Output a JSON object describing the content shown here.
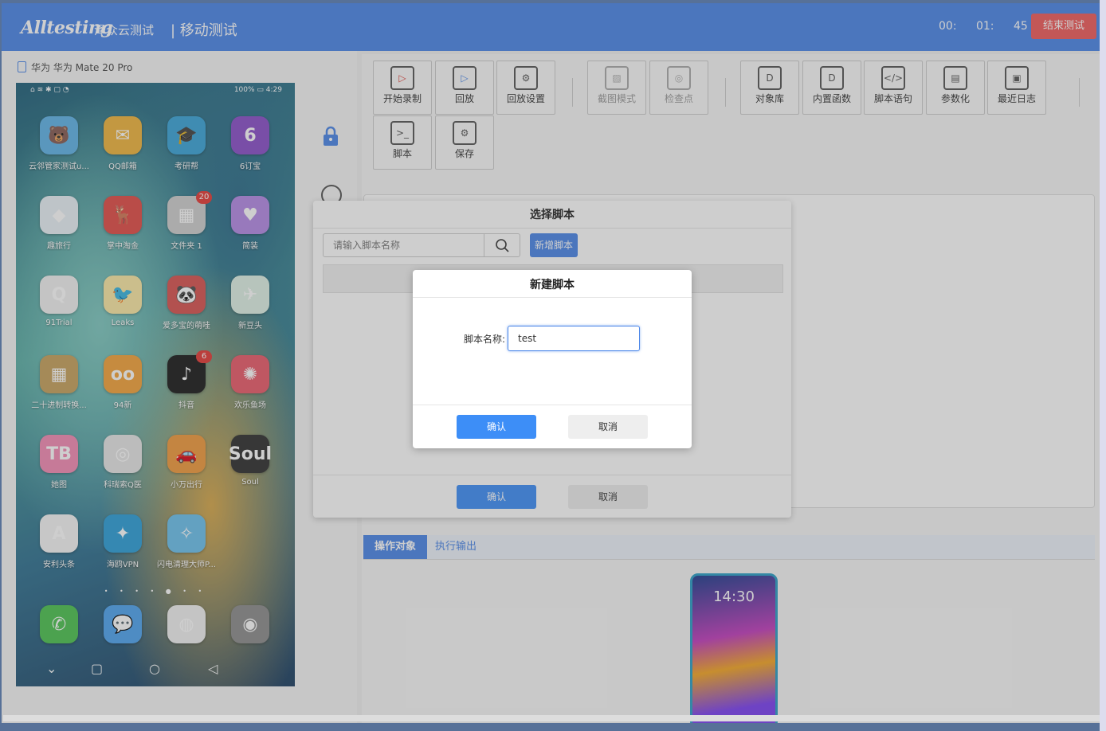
{
  "header": {
    "logo": "Alltesting",
    "logo_cn": "泽众云测试",
    "section": "| 移动测试",
    "timer": {
      "h": "00:",
      "m": "01:",
      "s": "45"
    },
    "end_button": "结束测试"
  },
  "device": {
    "label": "华为 华为 Mate 20 Pro",
    "status_left": "⌂ ≋ ✱ ▢ ◔",
    "status_right": "100% ▭ 4:29",
    "apps": [
      {
        "label": "云邻管家测试u...",
        "color": "#5fb3e8",
        "glyph": "🐻"
      },
      {
        "label": "QQ邮箱",
        "color": "#f0b43c",
        "glyph": "✉"
      },
      {
        "label": "考研帮",
        "color": "#3aa4d8",
        "glyph": "🎓"
      },
      {
        "label": "6订宝",
        "color": "#8a4ec9",
        "glyph": "6"
      },
      {
        "label": "趣旅行",
        "color": "#e9f1f7",
        "glyph": "◆"
      },
      {
        "label": "掌中淘金",
        "color": "#e24b46",
        "glyph": "🦌"
      },
      {
        "label": "文件夹 1",
        "color": "#cfcfcf",
        "glyph": "▦",
        "badge": "20"
      },
      {
        "label": "简装",
        "color": "#b48ae6",
        "glyph": "♥"
      },
      {
        "label": "91Trial",
        "color": "#f2f2f2",
        "glyph": "Q"
      },
      {
        "label": "Leaks",
        "color": "#fbe9a4",
        "glyph": "🐦"
      },
      {
        "label": "爱多宝的萌哇",
        "color": "#d9534f",
        "glyph": "🐼"
      },
      {
        "label": "新豆头",
        "color": "#dff2e6",
        "glyph": "✈"
      },
      {
        "label": "二十进制转换...",
        "color": "#c7a15c",
        "glyph": "▦"
      },
      {
        "label": "94新",
        "color": "#f4a23a",
        "glyph": "oo"
      },
      {
        "label": "抖音",
        "color": "#1a1a1a",
        "glyph": "♪",
        "badge": "6"
      },
      {
        "label": "欢乐鱼场",
        "color": "#ea5a6a",
        "glyph": "✺"
      },
      {
        "label": "她图",
        "color": "#f48bb5",
        "glyph": "TB"
      },
      {
        "label": "科瑞索Q医",
        "color": "#e6e6e6",
        "glyph": "◎"
      },
      {
        "label": "小万出行",
        "color": "#f29a3c",
        "glyph": "🚗"
      },
      {
        "label": "Soul",
        "color": "#2f2f2f",
        "glyph": "Soul"
      },
      {
        "label": "安利头条",
        "color": "#f5f5f5",
        "glyph": "A"
      },
      {
        "label": "海鸥VPN",
        "color": "#2b9ed8",
        "glyph": "✦"
      },
      {
        "label": "闪电清理大师P...",
        "color": "#6bc1ee",
        "glyph": "✧"
      }
    ],
    "dock": [
      {
        "color": "#4cc34f",
        "glyph": "✆"
      },
      {
        "color": "#4ea4f0",
        "glyph": "💬"
      },
      {
        "color": "#f2f2f2",
        "glyph": "◍"
      },
      {
        "color": "#8c8c8c",
        "glyph": "◉"
      }
    ],
    "page_dots": "• • • • ● • •"
  },
  "toolbar": {
    "buttons": [
      {
        "label": "开始录制",
        "glyph": "▷",
        "disabled": false
      },
      {
        "label": "回放",
        "glyph": "▷",
        "disabled": false
      },
      {
        "label": "回放设置",
        "glyph": "⚙",
        "disabled": false
      },
      {
        "label": "截图模式",
        "glyph": "▨",
        "disabled": true
      },
      {
        "label": "检查点",
        "glyph": "◎",
        "disabled": true
      },
      {
        "label": "对象库",
        "glyph": "D",
        "disabled": false
      },
      {
        "label": "内置函数",
        "glyph": "D",
        "disabled": false
      },
      {
        "label": "脚本语句",
        "glyph": "</>",
        "disabled": false
      },
      {
        "label": "参数化",
        "glyph": "▤",
        "disabled": false
      },
      {
        "label": "最近日志",
        "glyph": "▣",
        "disabled": false
      },
      {
        "label": "脚本",
        "glyph": ">_",
        "disabled": false
      },
      {
        "label": "保存",
        "glyph": "⚙",
        "disabled": false
      }
    ]
  },
  "bottom_tabs": {
    "active": "操作对象",
    "inactive": "执行输出"
  },
  "preview_clock": "14:30",
  "dialog_select": {
    "title": "选择脚本",
    "search_placeholder": "请输入脚本名称",
    "add_button": "新增脚本",
    "ok": "确认",
    "cancel": "取消"
  },
  "dialog_new": {
    "title": "新建脚本",
    "field_label": "脚本名称:",
    "field_value": "test",
    "ok": "确认",
    "cancel": "取消"
  }
}
